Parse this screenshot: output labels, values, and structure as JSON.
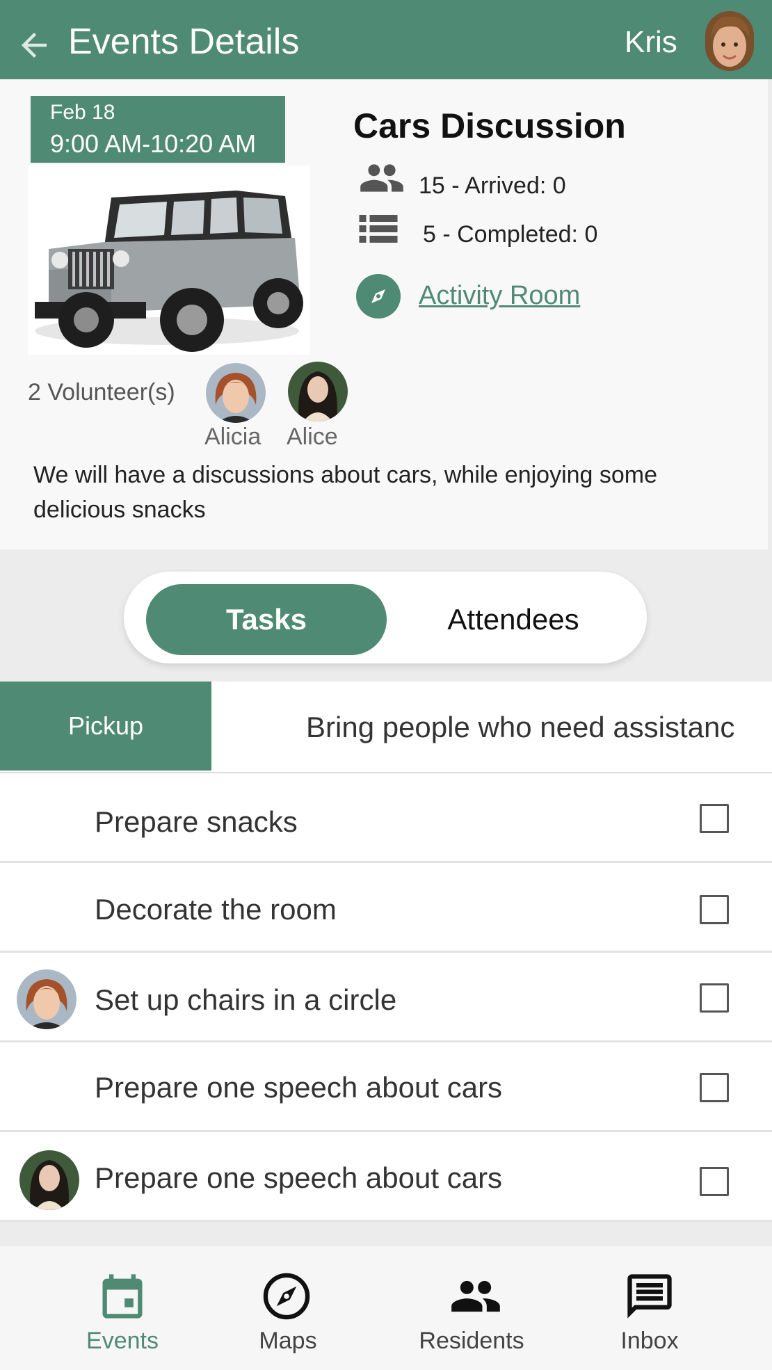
{
  "header": {
    "title": "Events Details",
    "user_name": "Kris",
    "back_icon": "arrow-left-icon",
    "avatar": "user-avatar"
  },
  "event": {
    "date": "Feb 18",
    "time": "9:00 AM-10:20 AM",
    "title": "Cars Discussion",
    "attendees_stat": "15 - Arrived: 0",
    "tasks_stat": "5 - Completed: 0",
    "room": "Activity Room",
    "volunteer_count": "2 Volunteer(s)",
    "volunteers": [
      {
        "name": "Alicia"
      },
      {
        "name": "Alice"
      }
    ],
    "description": "We will have a discussions about cars, while enjoying some delicious snacks"
  },
  "tabs": [
    {
      "label": "Tasks",
      "active": true
    },
    {
      "label": "Attendees",
      "active": false
    }
  ],
  "pickup": {
    "label": "Pickup",
    "description": "Bring people who need assistanc"
  },
  "tasks": [
    {
      "label": "Prepare snacks",
      "assignee": ""
    },
    {
      "label": "Decorate the room",
      "assignee": ""
    },
    {
      "label": "Set up chairs in a circle",
      "assignee": "Alicia"
    },
    {
      "label": "Prepare one speech about cars",
      "assignee": ""
    },
    {
      "label": "Prepare one speech about cars",
      "assignee": "Alice"
    }
  ],
  "nav": [
    {
      "label": "Events",
      "icon": "calendar-icon",
      "active": true
    },
    {
      "label": "Maps",
      "icon": "compass-icon",
      "active": false
    },
    {
      "label": "Residents",
      "icon": "people-icon",
      "active": false
    },
    {
      "label": "Inbox",
      "icon": "message-icon",
      "active": false
    }
  ],
  "colors": {
    "primary": "#4f8a74",
    "header_text": "#ffffff",
    "background": "#ececec"
  }
}
